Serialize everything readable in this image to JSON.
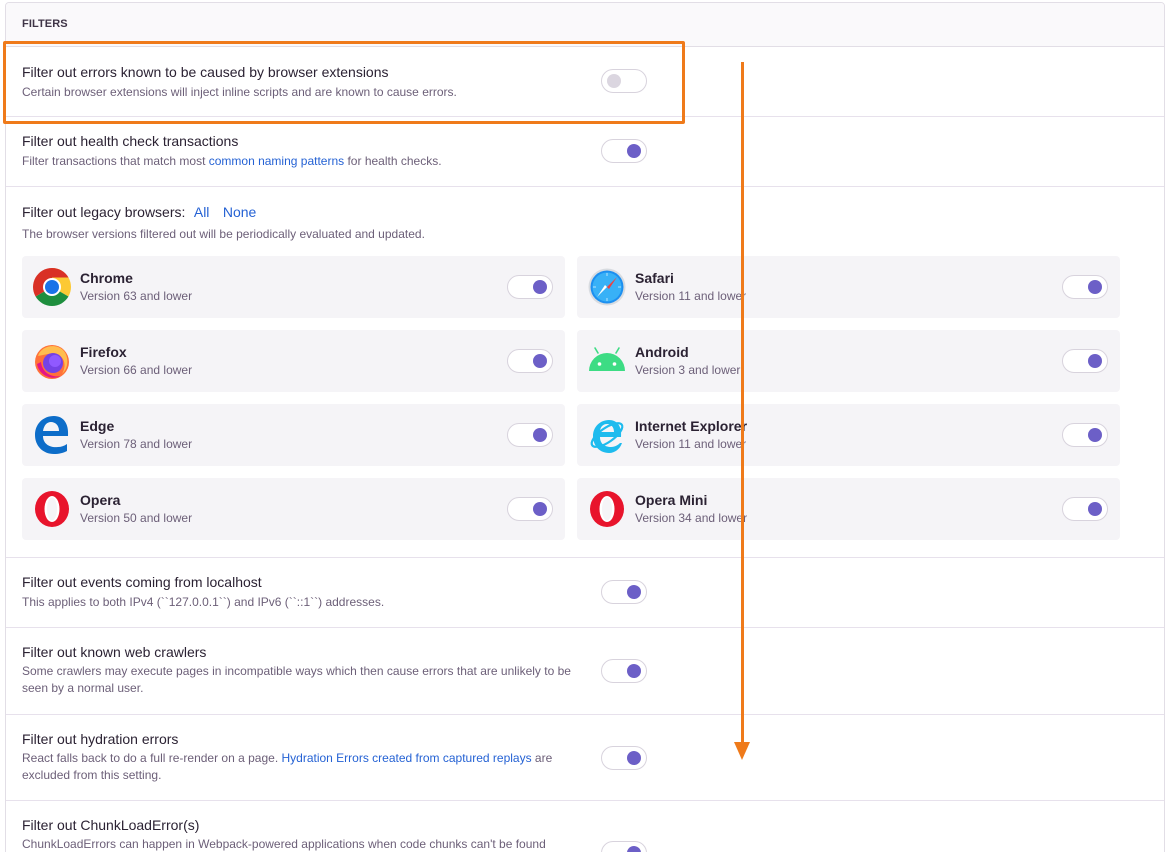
{
  "header": {
    "title": "FILTERS"
  },
  "filters": {
    "extensions": {
      "title": "Filter out errors known to be caused by browser extensions",
      "desc": "Certain browser extensions will inject inline scripts and are known to cause errors.",
      "enabled": false
    },
    "health": {
      "title": "Filter out health check transactions",
      "desc_pre": "Filter transactions that match most ",
      "desc_link": "common naming patterns",
      "desc_post": " for health checks.",
      "enabled": true
    },
    "legacy": {
      "title": "Filter out legacy browsers:",
      "all_label": "All",
      "none_label": "None",
      "desc": "The browser versions filtered out will be periodically evaluated and updated.",
      "browsers": [
        {
          "name": "Chrome",
          "version": "Version 63 and lower",
          "icon": "chrome-icon",
          "enabled": true
        },
        {
          "name": "Safari",
          "version": "Version 11 and lower",
          "icon": "safari-icon",
          "enabled": true
        },
        {
          "name": "Firefox",
          "version": "Version 66 and lower",
          "icon": "firefox-icon",
          "enabled": true
        },
        {
          "name": "Android",
          "version": "Version 3 and lower",
          "icon": "android-icon",
          "enabled": true
        },
        {
          "name": "Edge",
          "version": "Version 78 and lower",
          "icon": "edge-icon",
          "enabled": true
        },
        {
          "name": "Internet Explorer",
          "version": "Version 11 and lower",
          "icon": "internet-explorer-icon",
          "enabled": true
        },
        {
          "name": "Opera",
          "version": "Version 50 and lower",
          "icon": "opera-icon",
          "enabled": true
        },
        {
          "name": "Opera Mini",
          "version": "Version 34 and lower",
          "icon": "opera-mini-icon",
          "enabled": true
        }
      ]
    },
    "localhost": {
      "title": "Filter out events coming from localhost",
      "desc": "This applies to both IPv4 (``127.0.0.1``) and IPv6 (``::1``) addresses.",
      "enabled": true
    },
    "crawlers": {
      "title": "Filter out known web crawlers",
      "desc": "Some crawlers may execute pages in incompatible ways which then cause errors that are unlikely to be seen by a normal user.",
      "enabled": true
    },
    "hydration": {
      "title": "Filter out hydration errors",
      "desc_pre": "React falls back to do a full re-render on a page. ",
      "desc_link": "Hydration Errors created from captured replays",
      "desc_post": " are excluded from this setting.",
      "enabled": true
    },
    "chunkload": {
      "title": "Filter out ChunkLoadError(s)",
      "desc": "ChunkLoadErrors can happen in Webpack-powered applications when code chunks can't be found",
      "enabled": true
    }
  },
  "colors": {
    "accent": "#6c5fc7",
    "link": "#2562d4",
    "annotation": "#ef7a1a"
  }
}
